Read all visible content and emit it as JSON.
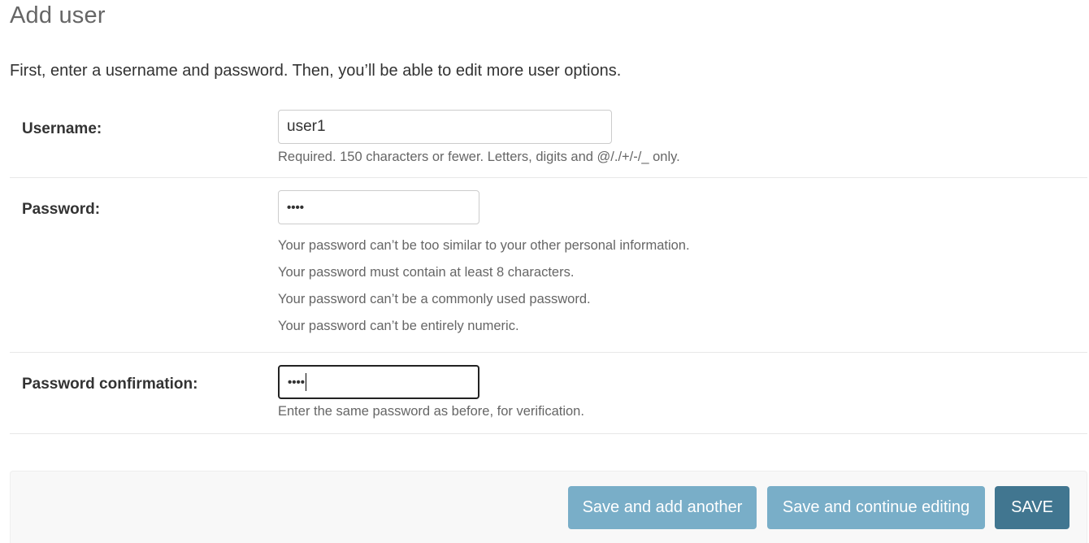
{
  "page": {
    "title": "Add user",
    "intro": "First, enter a username and password. Then, you’ll be able to edit more user options."
  },
  "form": {
    "username": {
      "label": "Username:",
      "value": "user1",
      "help": "Required. 150 characters or fewer. Letters, digits and @/./+/-/_ only."
    },
    "password": {
      "label": "Password:",
      "masked_value": "••••",
      "help": [
        "Your password can’t be too similar to your other personal information.",
        "Your password must contain at least 8 characters.",
        "Your password can’t be a commonly used password.",
        "Your password can’t be entirely numeric."
      ]
    },
    "password_confirmation": {
      "label": "Password confirmation:",
      "masked_value": "••••",
      "help": "Enter the same password as before, for verification.",
      "focused": true
    }
  },
  "submit_row": {
    "save_add_another": "Save and add another",
    "save_continue": "Save and continue editing",
    "save": "SAVE"
  },
  "colors": {
    "button_light": "#79aec8",
    "button_primary": "#417690",
    "submit_row_bg": "#f8f8f8",
    "help_text": "#666666"
  }
}
